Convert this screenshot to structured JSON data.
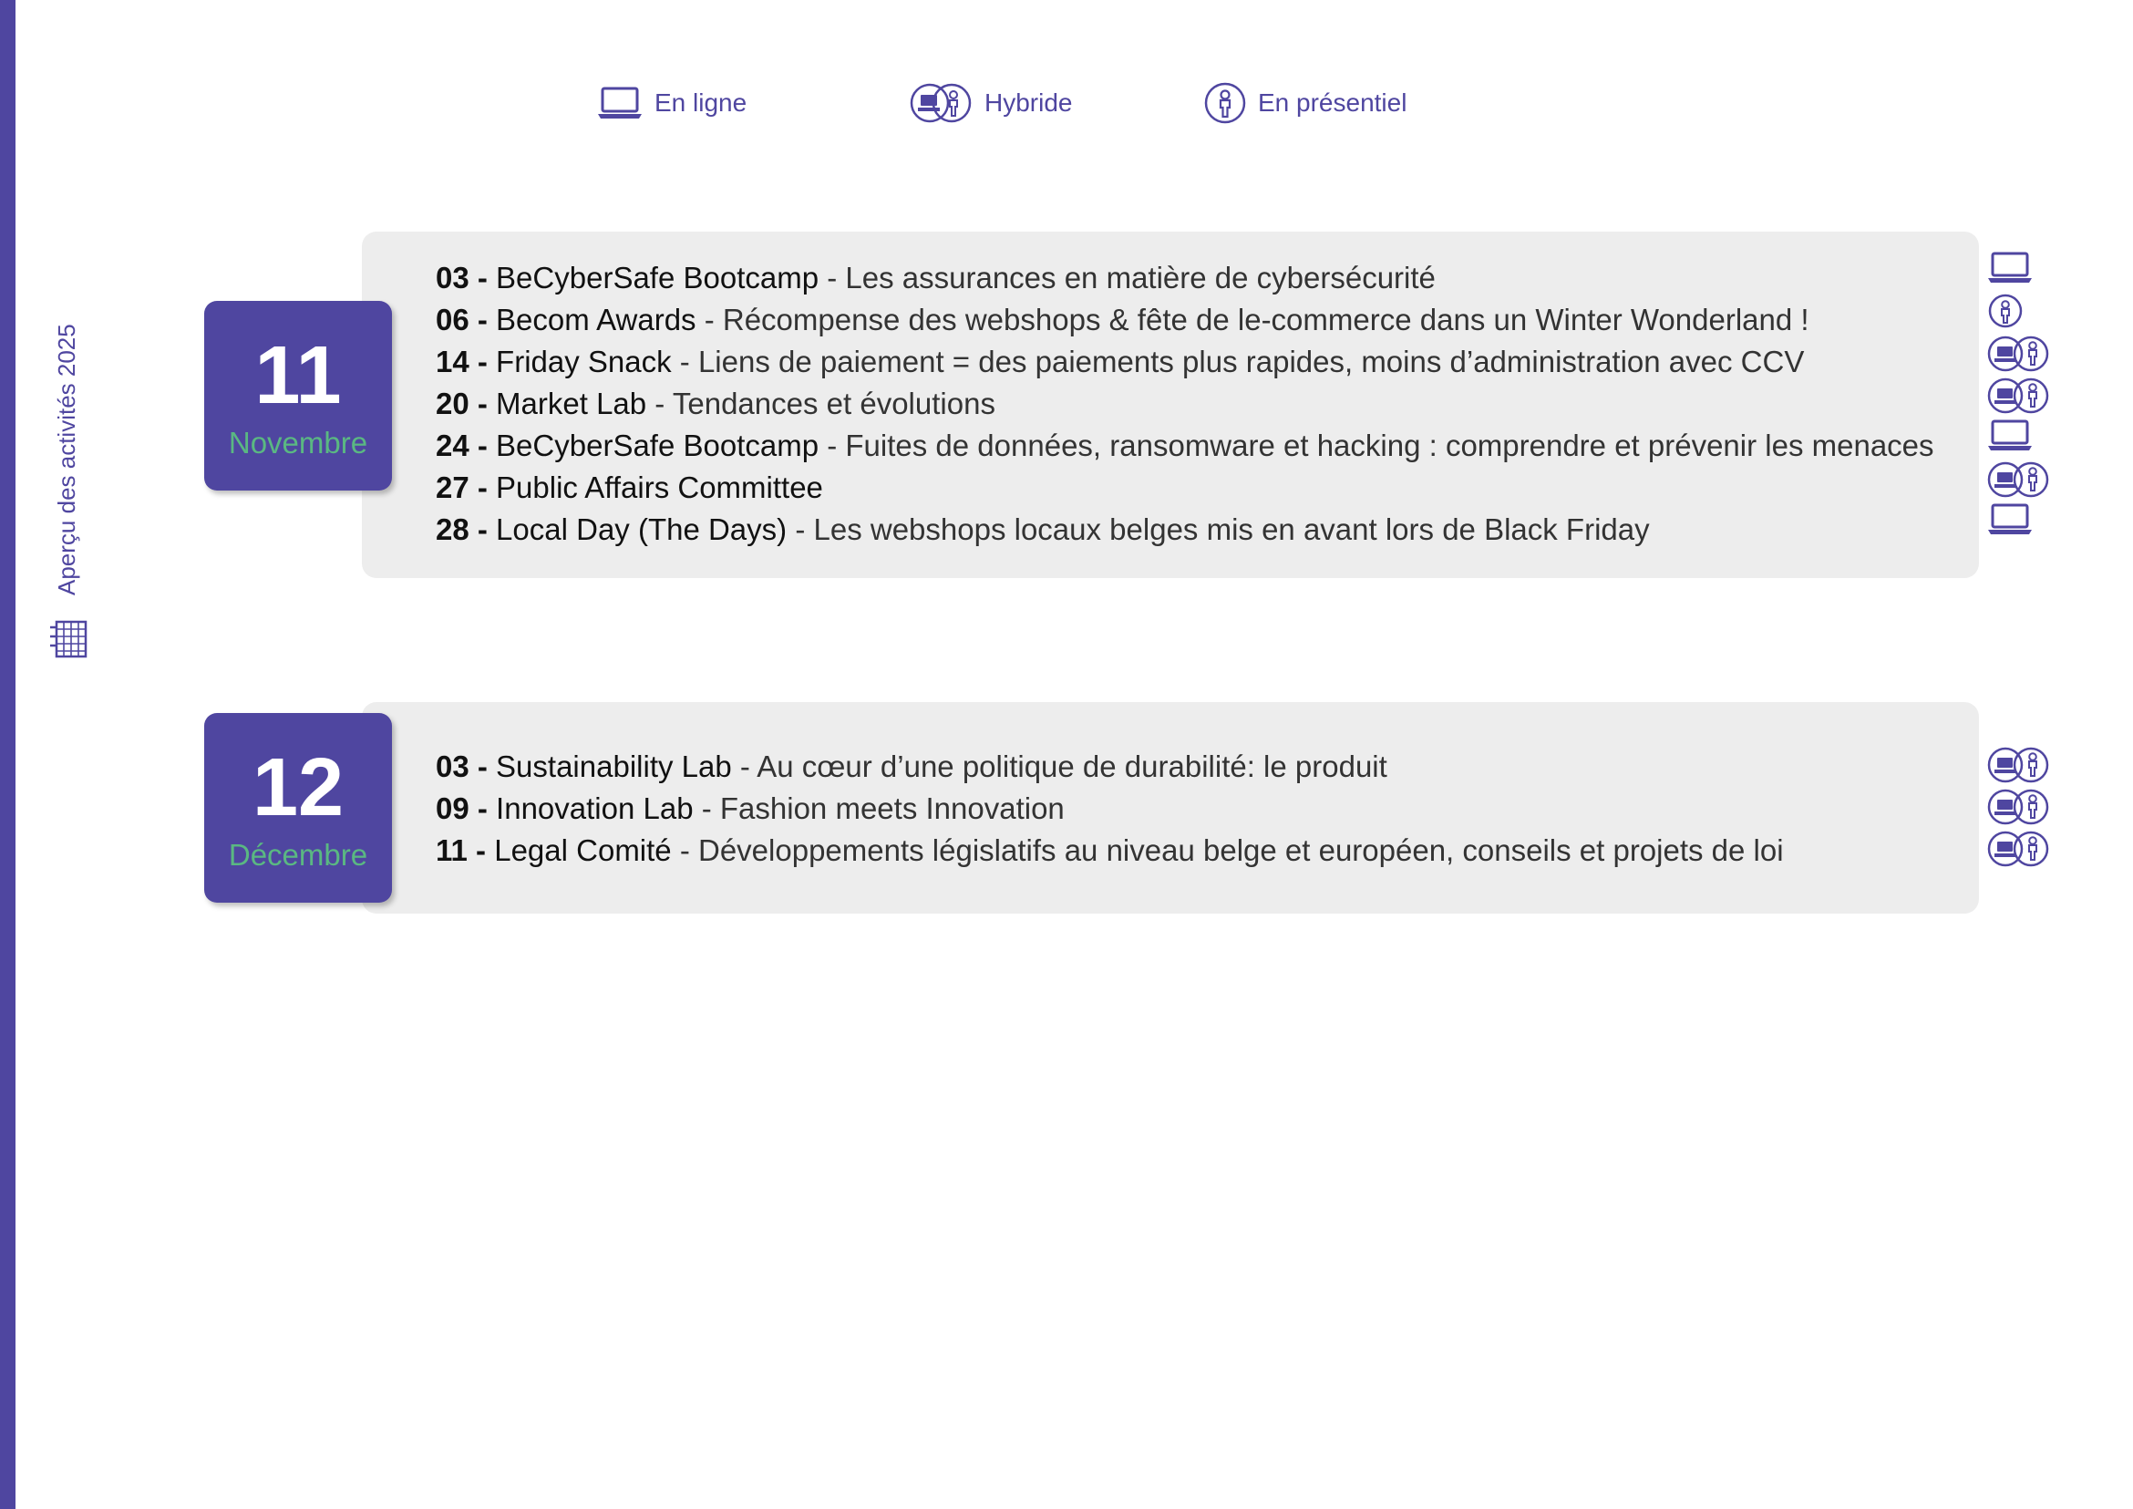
{
  "sidebar": {
    "title": "Aperçu des activités 2025",
    "icon": "calendar-grid-icon"
  },
  "colors": {
    "accent": "#4f46a0",
    "month_label": "#5ab882",
    "card_background": "#ededed",
    "text": "#1f1f1f"
  },
  "legend": [
    {
      "label": "En ligne",
      "icon": "laptop-icon"
    },
    {
      "label": "Hybride",
      "icon": "hybrid-icon"
    },
    {
      "label": "En présentiel",
      "icon": "person-icon"
    }
  ],
  "months": [
    {
      "number": "11",
      "name": "Novembre",
      "events": [
        {
          "day": "03 -",
          "title": "BeCyberSafe Bootcamp",
          "description": " - Les assurances en matière de cybersécurité",
          "mode": "En ligne"
        },
        {
          "day": "06 -",
          "title": "Becom Awards",
          "description": " - Récompense des webshops & fête de le-commerce dans un Winter Wonderland !",
          "mode": "En présentiel"
        },
        {
          "day": "14 -",
          "title": "Friday Snack",
          "description": " - Liens de paiement = des paiements plus rapides, moins d’administration avec CCV",
          "mode": "Hybride"
        },
        {
          "day": "20 -",
          "title": "Market Lab",
          "description": " - Tendances et évolutions",
          "mode": "Hybride"
        },
        {
          "day": "24 -",
          "title": "BeCyberSafe Bootcamp",
          "description": " - Fuites de données, ransomware et hacking : comprendre et prévenir les menaces",
          "mode": "En ligne"
        },
        {
          "day": "27 -",
          "title": "Public Affairs Committee",
          "description": "",
          "mode": "Hybride"
        },
        {
          "day": "28 -",
          "title": "Local Day (The Days)",
          "description": " - Les webshops locaux belges mis en avant lors de Black Friday",
          "mode": "En ligne"
        }
      ]
    },
    {
      "number": "12",
      "name": "Décembre",
      "events": [
        {
          "day": "03 -",
          "title": "Sustainability Lab",
          "description": " - Au cœur d’une politique de durabilité: le produit",
          "mode": "Hybride"
        },
        {
          "day": "09 -",
          "title": "Innovation Lab",
          "description": " - Fashion meets Innovation",
          "mode": "Hybride"
        },
        {
          "day": "11 -",
          "title": "Legal Comité",
          "description": " - Développements législatifs au niveau belge et européen, conseils et projets de loi",
          "mode": "Hybride"
        }
      ]
    }
  ]
}
